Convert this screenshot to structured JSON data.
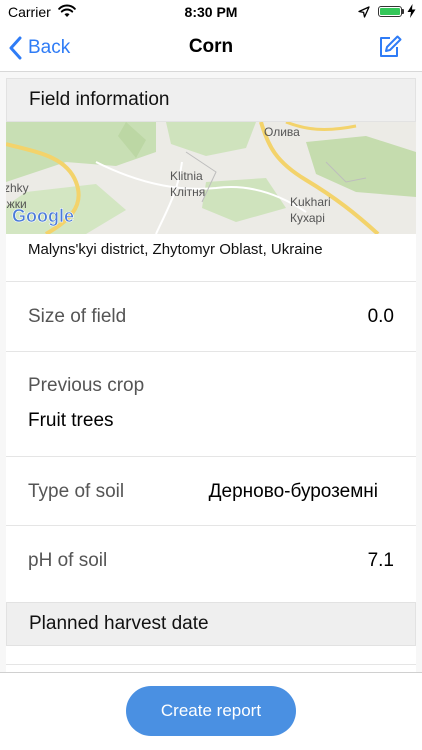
{
  "status_bar": {
    "carrier": "Carrier",
    "time": "8:30 PM",
    "battery_level": 1.0,
    "icons": [
      "wifi-icon",
      "location-arrow-icon",
      "battery-icon",
      "charging-bolt-icon"
    ]
  },
  "nav": {
    "back_label": "Back",
    "title": "Corn",
    "back_icon": "chevron-left-icon",
    "edit_icon": "compose-icon"
  },
  "field_info": {
    "header": "Field information",
    "map": {
      "labels": {
        "oliva": "Олива",
        "klitnia_latin": "Klitnia",
        "klitnia_cyr": "Клітня",
        "kukhari_latin": "Kukhari",
        "kukhari_cyr": "Кухарі",
        "left_latin": "zhky",
        "left_cyr": "іжки"
      },
      "logo": "Google"
    },
    "location": "Malyns'kyi district, Zhytomyr Oblast, Ukraine",
    "size": {
      "label": "Size of field",
      "value": "0.0"
    },
    "previous_crop": {
      "label": "Previous crop",
      "value": "Fruit trees"
    },
    "soil_type": {
      "label": "Type of soil",
      "value": "Дерново-буроземні"
    },
    "soil_ph": {
      "label": "pH of soil",
      "value": "7.1"
    }
  },
  "harvest": {
    "header": "Planned harvest date"
  },
  "actions": {
    "create_report": "Create report"
  },
  "colors": {
    "accent": "#2f7cf6",
    "button": "#4a90e2",
    "header_bg": "#efefef"
  }
}
